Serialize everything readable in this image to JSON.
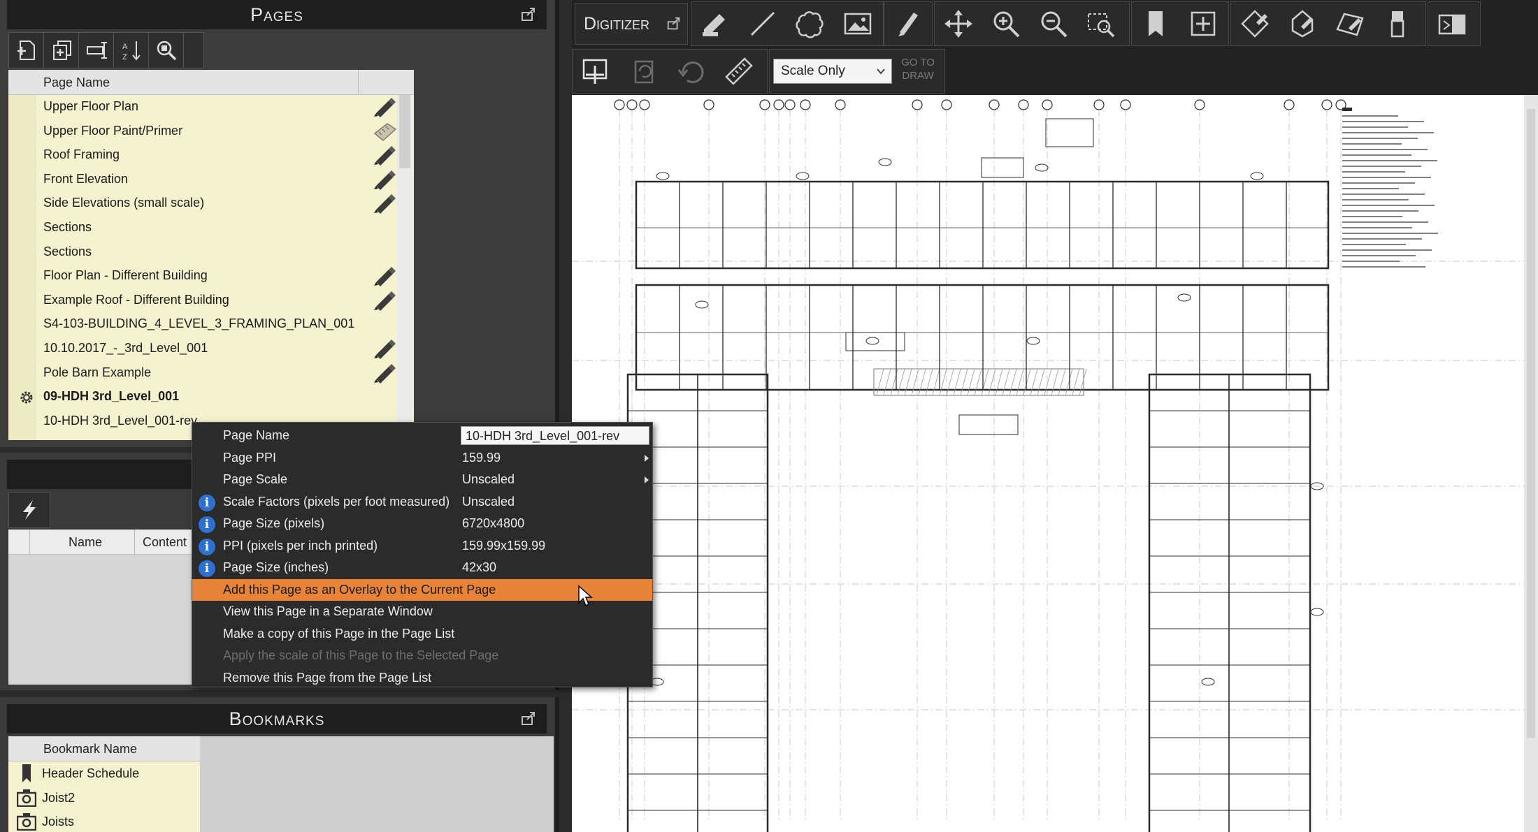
{
  "pages_panel": {
    "title": "Pages",
    "column_header": "Page Name",
    "toolbar": [
      "add-page-icon",
      "add-pages-icon",
      "page-properties-icon",
      "sort-icon",
      "find-page-icon"
    ],
    "rows": [
      {
        "name": "Upper Floor Plan",
        "icon": "pencil"
      },
      {
        "name": "Upper Floor Paint/Primer",
        "icon": "pencil-scale"
      },
      {
        "name": "Roof Framing",
        "icon": "pencil"
      },
      {
        "name": "Front Elevation",
        "icon": "pencil"
      },
      {
        "name": "Side Elevations (small scale)",
        "icon": "pencil"
      },
      {
        "name": "Sections",
        "icon": ""
      },
      {
        "name": "Sections",
        "icon": ""
      },
      {
        "name": "Floor Plan - Different Building",
        "icon": "pencil"
      },
      {
        "name": "Example Roof - Different Building",
        "icon": "pencil"
      },
      {
        "name": "S4-103-BUILDING_4_LEVEL_3_FRAMING_PLAN_001",
        "icon": ""
      },
      {
        "name": "10.10.2017_-_3rd_Level_001",
        "icon": "pencil"
      },
      {
        "name": "Pole Barn Example",
        "icon": "pencil"
      },
      {
        "name": "09-HDH 3rd_Level_001",
        "icon": "gear",
        "current": true
      },
      {
        "name": "10-HDH 3rd_Level_001-rev",
        "icon": ""
      }
    ]
  },
  "mid_panel": {
    "columns": [
      "Name",
      "Content"
    ]
  },
  "bookmarks_panel": {
    "title": "Bookmarks",
    "column_header": "Bookmark Name",
    "rows": [
      {
        "name": "Header Schedule",
        "icon": "bookmark-icon"
      },
      {
        "name": "Joist2",
        "icon": "camera-icon"
      },
      {
        "name": "Joists",
        "icon": "camera-icon"
      }
    ]
  },
  "digitizer": {
    "title": "Digitizer",
    "scale_mode": "Scale Only",
    "goto_draw": "GO TO DRAW"
  },
  "context_menu": {
    "items": [
      {
        "label": "Page Name",
        "value": "10-HDH 3rd_Level_001-rev",
        "type": "input"
      },
      {
        "label": "Page PPI",
        "value": "159.99",
        "submenu": true
      },
      {
        "label": "Page Scale",
        "value": "Unscaled",
        "submenu": true
      },
      {
        "label": "Scale Factors (pixels per foot measured)",
        "value": "Unscaled",
        "info": true
      },
      {
        "label": "Page Size (pixels)",
        "value": "6720x4800",
        "info": true
      },
      {
        "label": "PPI (pixels per inch printed)",
        "value": "159.99x159.99",
        "info": true
      },
      {
        "label": "Page Size (inches)",
        "value": "42x30",
        "info": true
      },
      {
        "label": "Add this Page as an Overlay to the Current Page",
        "highlight": true
      },
      {
        "label": "View this Page in a Separate Window"
      },
      {
        "label": "Make a copy of this Page in the Page List"
      },
      {
        "label": "Apply the scale of this Page to the Selected Page",
        "disabled": true
      },
      {
        "label": "Remove this Page from the Page List"
      }
    ]
  },
  "colors": {
    "menu_highlight": "#e8833a",
    "grid_background": "#f5f3cf",
    "info_icon": "#2f6fd0"
  }
}
